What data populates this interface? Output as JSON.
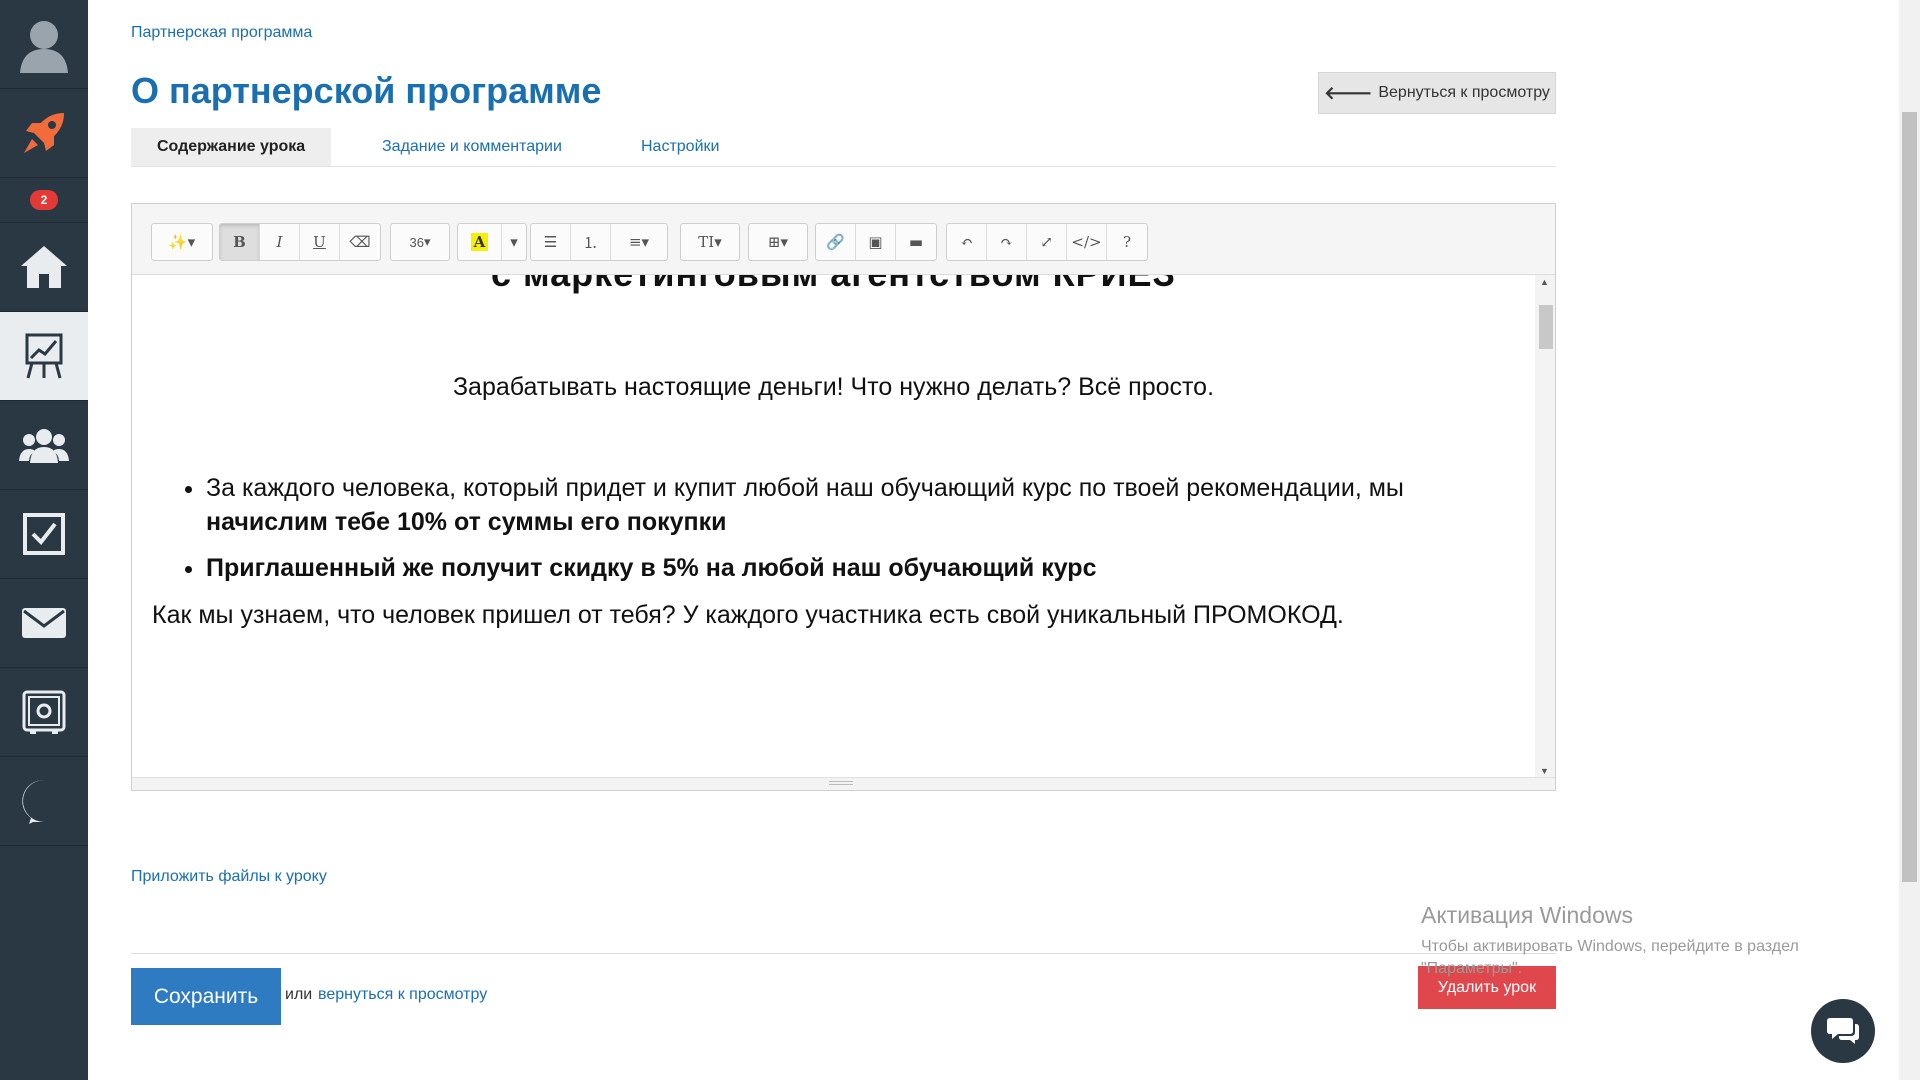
{
  "breadcrumb": "Партнерская программа",
  "page_title": "О партнерской программе",
  "back_button": "Вернуться к просмотру",
  "tabs": [
    {
      "label": "Содержание урока"
    },
    {
      "label": "Задание и комментарии"
    },
    {
      "label": "Настройки"
    }
  ],
  "sidebar": {
    "badge_count": "2",
    "items": [
      {
        "icon": "user-avatar-icon"
      },
      {
        "icon": "rocket-icon"
      },
      {
        "icon": "home-icon"
      },
      {
        "icon": "chart-board-icon",
        "active": true
      },
      {
        "icon": "users-group-icon"
      },
      {
        "icon": "checkbox-icon"
      },
      {
        "icon": "mail-icon"
      },
      {
        "icon": "safe-icon"
      },
      {
        "icon": "c-logo-icon"
      }
    ]
  },
  "toolbar": {
    "font_size": "36"
  },
  "editor_content": {
    "cut_heading": "с маркетинговым агентством КРИЕЗ",
    "lead": "Зарабатывать настоящие деньги! Что нужно делать? Всё просто.",
    "bullet1_plain": "За каждого человека, который придет и купит любой наш обучающий курс по твоей рекомендации, мы",
    "bullet1_bold": "начислим тебе 10% от суммы его покупки",
    "bullet2_bold": "Приглашенный же получит скидку в 5% на любой наш обучающий курс",
    "closing": "Как мы узнаем, что человек пришел от тебя? У каждого участника есть свой уникальный ПРОМОКОД."
  },
  "attach_link": "Приложить файлы к уроку",
  "save_button": "Сохранить",
  "or_text": "или",
  "back_link": "вернуться к просмотру",
  "delete_button": "Удалить урок",
  "windows_watermark": {
    "title": "Активация Windows",
    "subtitle": "Чтобы активировать Windows, перейдите в раздел \"Параметры\"."
  },
  "colors": {
    "sidebar_bg": "#2a3844",
    "link": "#1a6fb0",
    "primary": "#2e7bc1",
    "danger": "#e0474c",
    "rocket": "#f26b3a"
  }
}
